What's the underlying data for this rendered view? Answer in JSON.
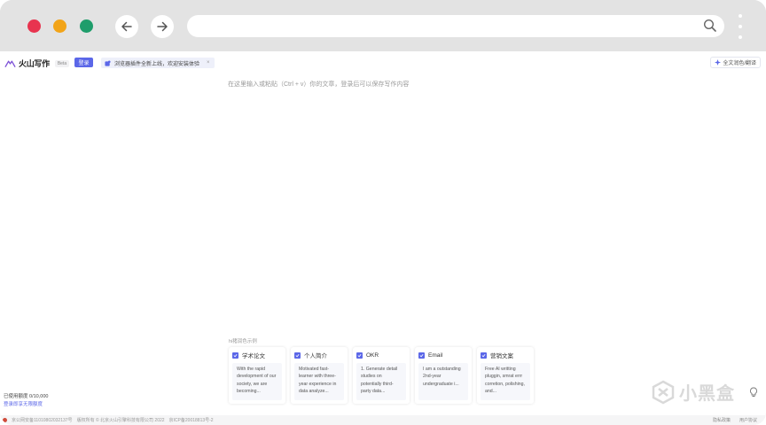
{
  "browser": {
    "back_icon": "arrow-left-icon",
    "forward_icon": "arrow-right-icon",
    "search_icon": "search-icon",
    "menu_icon": "kebab-menu-icon",
    "url": ""
  },
  "app": {
    "name": "火山写作",
    "beta": "Beta",
    "login_label": "登录",
    "notice_text": "浏览器插件全新上线，欢迎安装体验",
    "polish_label": "全文润色/翻译",
    "accent_color": "#5b67e8"
  },
  "editor": {
    "placeholder": "在这里输入或粘贴（Ctrl + v）你的文章，登录后可以保存写作内容"
  },
  "examples": {
    "label": "hi猪润色示例",
    "cards": [
      {
        "title": "学术论文",
        "text": "With the rapid development of our society, we are becoming..."
      },
      {
        "title": "个人简介",
        "text": "Motivated fast-learner with three-year experience in data analyze..."
      },
      {
        "title": "OKR",
        "text": "1. Generate detail studies on potentially third-party data..."
      },
      {
        "title": "Email",
        "text": "I am a outstanding 2nd-year undergraduate i..."
      },
      {
        "title": "营销文案",
        "text": "Free AI writting pluggin, smrat errr corretion, polishing, and..."
      }
    ]
  },
  "usage": {
    "count": "已使用额度 0/10,000",
    "link": "登录即享无限额度"
  },
  "footer": {
    "police": "京公网安备11010802032137号",
    "copyright": "版权所有 © 北京火山引擎科技有限公司 2022",
    "icp": "京ICP备20018813号-2",
    "privacy": "隐私政策",
    "terms": "用户协议"
  },
  "watermark": "小黑盒"
}
